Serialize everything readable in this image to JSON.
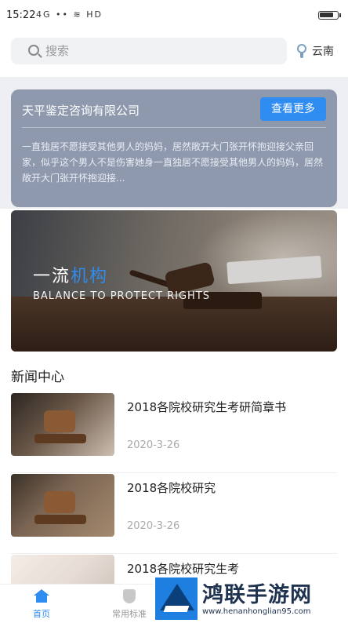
{
  "status_bar": {
    "time": "15:22",
    "indicators": "4G •• ≋ HD",
    "battery_level": 0.8
  },
  "search": {
    "placeholder": "搜索",
    "location": "云南"
  },
  "company": {
    "name": "天平鉴定咨询有限公司",
    "more_label": "查看更多",
    "description": "一直独居不愿接受其他男人的妈妈，居然敞开大门张开怀抱迎接父亲回家，似乎这个男人不是伤害她身一直独居不愿接受其他男人的妈妈，居然敞开大门张开怀抱迎接..."
  },
  "banner": {
    "title_plain": "一流",
    "title_highlight": "机构",
    "subtitle": "BALANCE TO PROTECT RIGHTS"
  },
  "news": {
    "heading": "新闻中心",
    "items": [
      {
        "title": "2018各院校研究生考研简章书",
        "date": "2020-3-26"
      },
      {
        "title": "2018各院校研究",
        "date": "2020-3-26"
      },
      {
        "title": "2018各院校研究生考",
        "date": ""
      }
    ]
  },
  "tabs": {
    "home": "首页",
    "standards": "常用标准"
  },
  "watermark": {
    "name": "鸿联手游网",
    "url": "www.henanhonglian95.com"
  },
  "colors": {
    "accent": "#2f8cf0",
    "card": "#8e99ae"
  }
}
